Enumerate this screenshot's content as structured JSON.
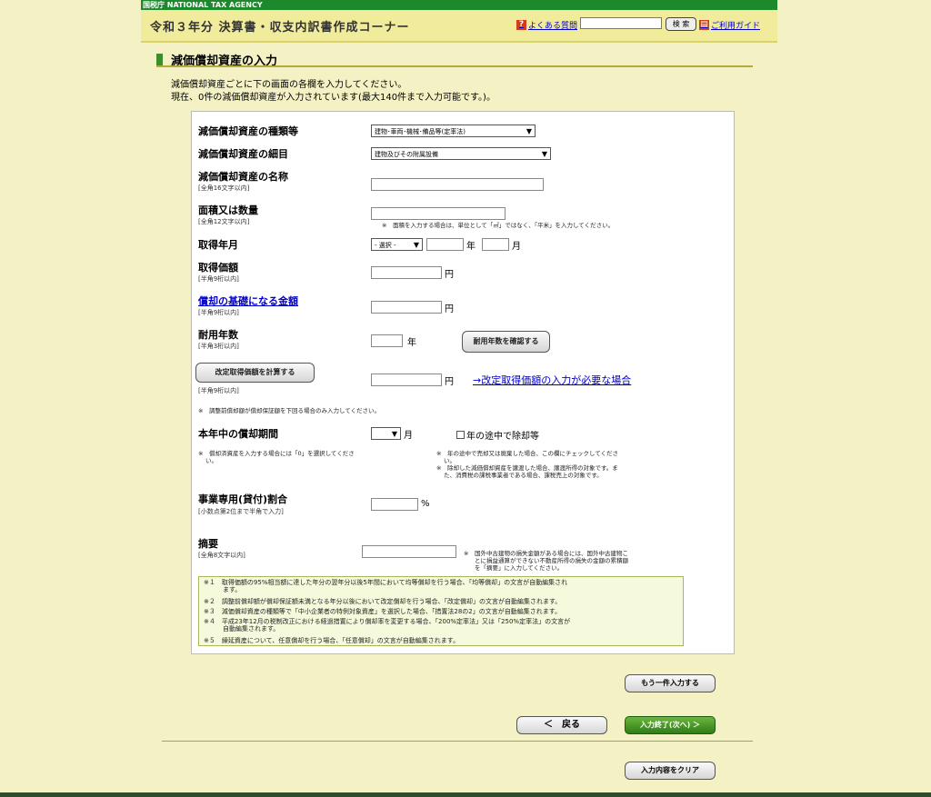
{
  "agency": "国税庁 NATIONAL TAX AGENCY",
  "header": {
    "title": "令和３年分 決算書・収支内訳書作成コーナー",
    "faq_label": "よくある質問",
    "search_button": "検 索",
    "guide_label": "ご利用ガイド"
  },
  "section": {
    "title": "減価償却資産の入力",
    "intro1": "減価償却資産ごとに下の画面の各欄を入力してください。",
    "intro2": "現在、0件の減価償却資産が入力されています(最大140件まで入力可能です。)。"
  },
  "form": {
    "kind_label": "減価償却資産の種類等",
    "kind_value": "建物･車両･機械･備品等(定率法)",
    "detail_label": "減価償却資産の細目",
    "detail_value": "建物及びその附属設備",
    "name_label": "減価償却資産の名称",
    "name_sub": "[全角16文字以内]",
    "area_label": "面積又は数量",
    "area_sub": "[全角12文字以内]",
    "area_note": "※　面積を入力する場合は、単位として「㎡」ではなく、「平米」を入力してください。",
    "acq_date_label": "取得年月",
    "acq_date_select": "- 選択 -",
    "year_unit": "年",
    "month_unit": "月",
    "acq_price_label": "取得価額",
    "acq_price_sub": "[半角9桁以内]",
    "yen": "円",
    "base_label": "償却の基礎になる金額",
    "base_sub": "[半角9桁以内]",
    "life_label": "耐用年数",
    "life_sub": "[半角3桁以内]",
    "life_unit": "年",
    "life_button": "耐用年数を確認する",
    "revised_button": "改定取得価額を計算する",
    "revised_sub": "[半角9桁以内]",
    "revised_link": "→改定取得価額の入力が必要な場合",
    "revised_note": "※　調整前償却額が償却保証額を下回る場合のみ入力してください。",
    "period_label": "本年中の償却期間",
    "period_unit": "月",
    "midyear_check": "年の途中で除却等",
    "period_note1": "※　償却済資産を入力する場合には「0」を選択してくださ",
    "period_note2": "い。",
    "midyear_note1": "※　年の途中で売却又は廃棄した場合、この欄にチェックしてくださ",
    "midyear_note2": "い。",
    "midyear_note3": "※　除却した減価償却資産を譲渡した場合、譲渡所得の対象です。ま",
    "midyear_note4": "た、消費税の課税事業者である場合、課税売上の対象です。",
    "ratio_label": "事業専用(貸付)割合",
    "ratio_sub": "[小数点第2位まで半角で入力]",
    "ratio_unit": "%",
    "memo_label": "摘要",
    "memo_sub": "[全角8文字以内]",
    "memo_note1": "※　国外中古建物の損失金額がある場合には、国外中古建物こ",
    "memo_note2": "とに損益通算ができない不動産所得の損失の金額の累積額",
    "memo_note3": "を「摘要」に入力してください。"
  },
  "footnotes": [
    "※１　取得価額の95%相当額に達した年分の翌年分以後5年間において均等償却を行う場合、「均等償却」の文言が自動編集され",
    "　　　ます。",
    "※２　調整前償却額が償却保証額未満となる年分以後において改定償却を行う場合、「改定償却」の文言が自動編集されます。",
    "※３　減価償却資産の種類等で「中小企業者の特例対象資産」を選択した場合、「措置法28の2」の文言が自動編集されます。",
    "※４　平成23年12月の税制改正における経過措置により償却率を変更する場合、「200%定率法」又は「250%定率法」の文言が",
    "　　　自動編集されます。",
    "※５　繰延資産について、任意償却を行う場合、「任意償却」の文言が自動編集されます。"
  ],
  "actions": {
    "another": "もう一件入力する",
    "back": "＜　戻る",
    "next": "入力終了(次へ) ＞",
    "clear": "入力内容をクリア"
  }
}
